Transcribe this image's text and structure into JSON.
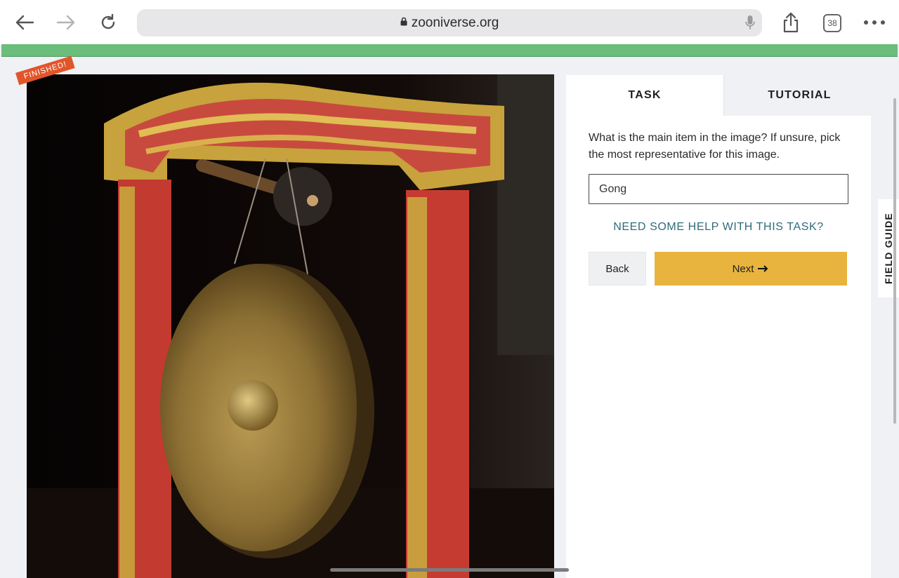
{
  "browser": {
    "url": "zooniverse.org",
    "tab_count": "38",
    "icons": [
      "back-arrow-icon",
      "forward-arrow-icon",
      "reload-icon",
      "lock-icon",
      "microphone-icon",
      "share-icon",
      "tabs-icon",
      "more-icon"
    ]
  },
  "subject": {
    "status_ribbon": "FINISHED!",
    "image": "brass gong hanging in red and gold carved dragon frame"
  },
  "task_panel": {
    "tabs": [
      {
        "label": "TASK",
        "active": true
      },
      {
        "label": "TUTORIAL",
        "active": false
      }
    ],
    "question": "What is the main item in the image? If unsure, pick the most representative for this image.",
    "selected_answer": "Gong",
    "help_link": "NEED SOME HELP WITH THIS TASK?",
    "back_label": "Back",
    "next_label": "Next"
  },
  "field_guide": {
    "label": "FIELD GUIDE"
  },
  "colors": {
    "progress": "#6bbd7c",
    "next_button": "#e8b43e",
    "help_link": "#2e6c79",
    "ribbon": "#e2552a"
  }
}
